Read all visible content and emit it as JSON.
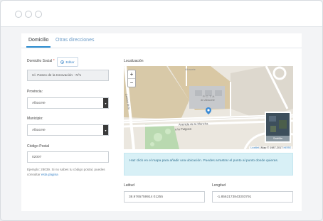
{
  "tabs": [
    "Domicilio",
    "Otras direcciones"
  ],
  "form": {
    "domicilio_social_label": "Domicilio Social",
    "required_mark": "*",
    "edit_button": "Editar",
    "domicilio_value": "Cl. Paseo de la Innovación · Nº1",
    "provincia_label": "Provincia:",
    "provincia_value": "Albacete",
    "municipio_label": "Municipio:",
    "municipio_value": "Albacete",
    "cp_label": "Código Postal",
    "cp_value": "02007",
    "help_text": "Ejemplo: 28039. Si no sabes tu código postal, puedes consultar",
    "help_link": "esta página"
  },
  "map": {
    "title": "Localización",
    "labels": {
      "campus": "P. C. T. A.",
      "campus_sub": "de Albacete",
      "avenida": "Avenida de la Mancha",
      "pulgosa": "a la Pulgosa",
      "camino": "Camino de la",
      "top": "Albacete"
    },
    "zoom_in": "+",
    "zoom_out": "−",
    "satellite_label": "Satélite",
    "attribution_link": "Leaflet",
    "attribution_text": "| Map © 1987-2017",
    "attribution_brand": "HERE"
  },
  "info_text": "Haz click en el mapa para añadir una ubicación. Puedes arrastrar el punto al punto donde quieras.",
  "coords": {
    "lat_label": "Latitud",
    "lat_value": "38.9765759914 01255",
    "lng_label": "Longitud",
    "lng_value": "-1.8562173843303791"
  },
  "colors": {
    "accent": "#2b8cd0",
    "info_bg": "#d8f0f6",
    "pin": "#3b8bd6"
  },
  "icons": {
    "edit": "location-icon",
    "select": "chevron-down-icon",
    "pin": "map-pin-icon"
  }
}
